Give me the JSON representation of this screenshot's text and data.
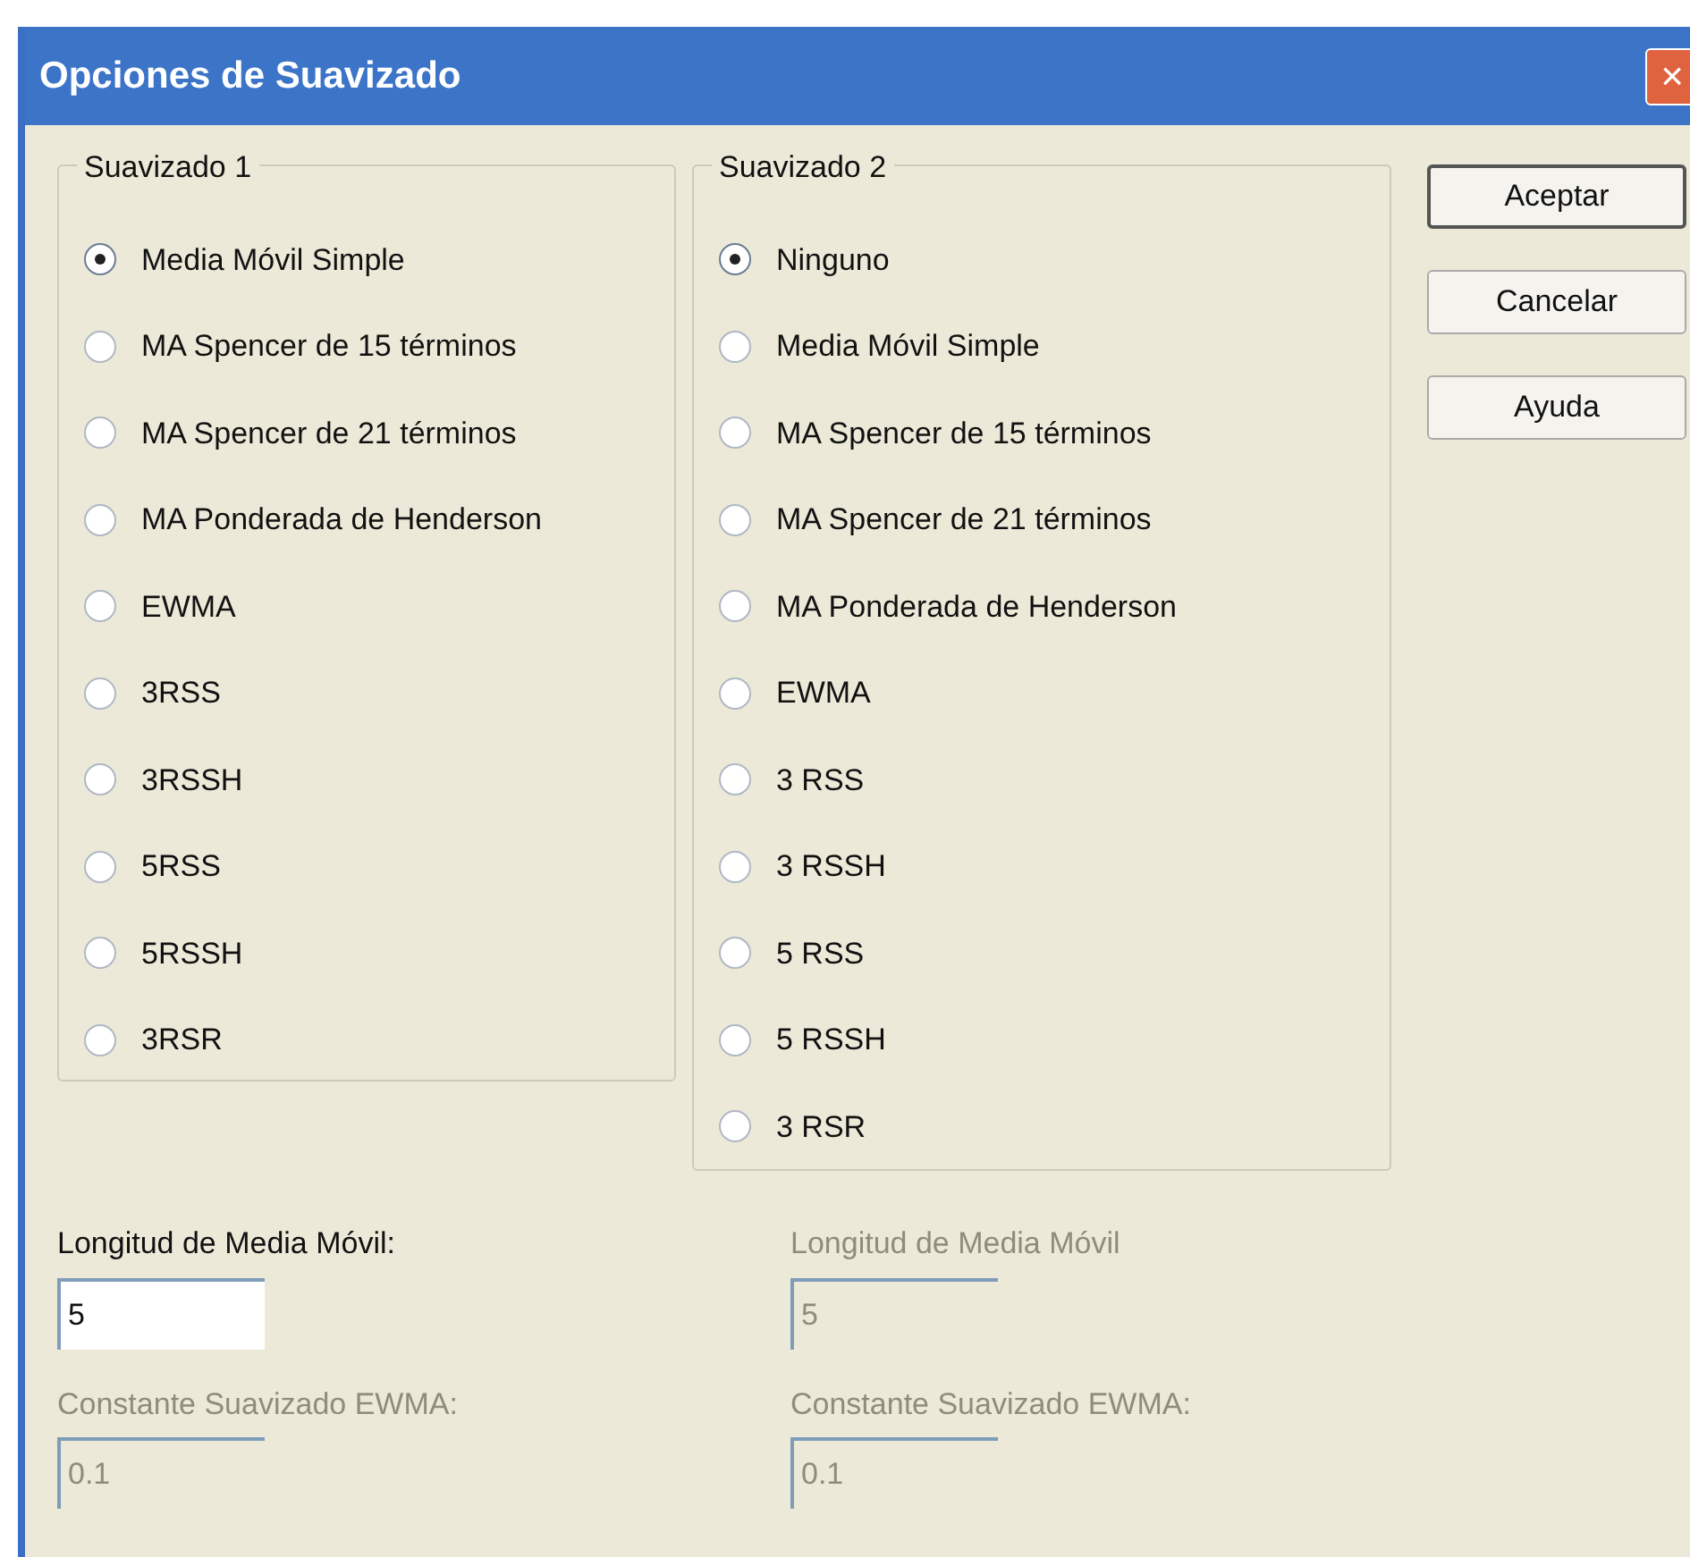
{
  "window": {
    "title": "Opciones de Suavizado",
    "close": "×"
  },
  "groups": [
    {
      "title": "Suavizado 1",
      "options": [
        {
          "label": "Media Móvil Simple",
          "selected": true
        },
        {
          "label": "MA Spencer de 15 términos",
          "selected": false
        },
        {
          "label": "MA Spencer de 21 términos",
          "selected": false
        },
        {
          "label": "MA Ponderada de Henderson",
          "selected": false
        },
        {
          "label": "EWMA",
          "selected": false
        },
        {
          "label": "3RSS",
          "selected": false
        },
        {
          "label": "3RSSH",
          "selected": false
        },
        {
          "label": "5RSS",
          "selected": false
        },
        {
          "label": "5RSSH",
          "selected": false
        },
        {
          "label": "3RSR",
          "selected": false
        }
      ]
    },
    {
      "title": "Suavizado 2",
      "options": [
        {
          "label": "Ninguno",
          "selected": true
        },
        {
          "label": "Media Móvil Simple",
          "selected": false
        },
        {
          "label": "MA Spencer de 15 términos",
          "selected": false
        },
        {
          "label": "MA Spencer de 21 términos",
          "selected": false
        },
        {
          "label": "MA Ponderada de Henderson",
          "selected": false
        },
        {
          "label": "EWMA",
          "selected": false
        },
        {
          "label": "3 RSS",
          "selected": false
        },
        {
          "label": "3 RSSH",
          "selected": false
        },
        {
          "label": "5 RSS",
          "selected": false
        },
        {
          "label": "5 RSSH",
          "selected": false
        },
        {
          "label": "3 RSR",
          "selected": false
        }
      ]
    }
  ],
  "buttons": [
    {
      "label": "Aceptar",
      "default": true
    },
    {
      "label": "Cancelar",
      "default": false
    },
    {
      "label": "Ayuda",
      "default": false
    }
  ],
  "fields": [
    [
      {
        "label": "Longitud de Media Móvil:",
        "value": "5",
        "disabled": false
      },
      {
        "label": "Constante Suavizado EWMA:",
        "value": "0.1",
        "disabled": true
      }
    ],
    [
      {
        "label": "Longitud de Media Móvil",
        "value": "5",
        "disabled": true
      },
      {
        "label": "Constante Suavizado EWMA:",
        "value": "0.1",
        "disabled": true
      }
    ]
  ]
}
